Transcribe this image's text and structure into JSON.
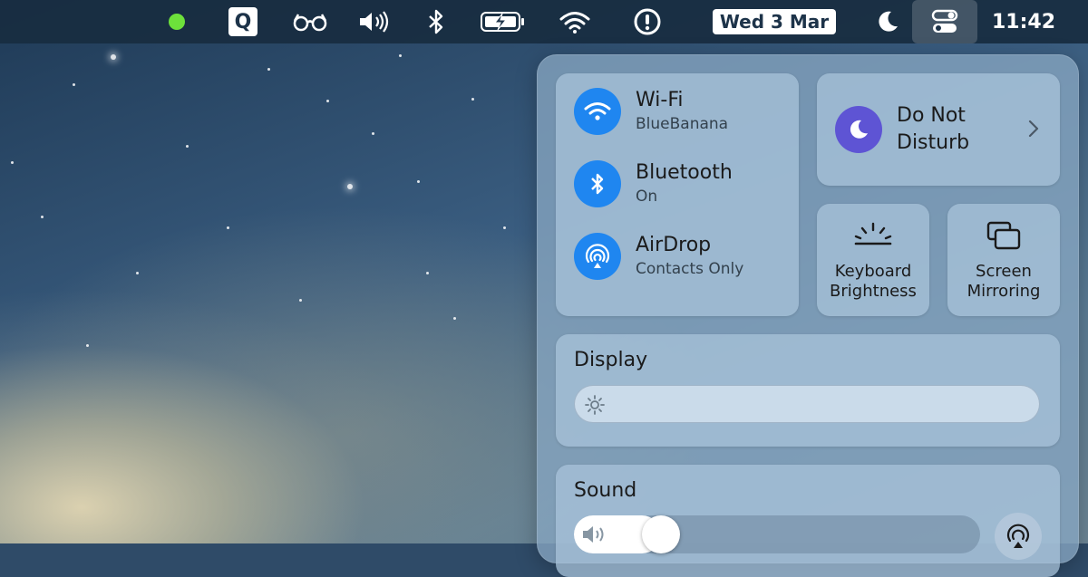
{
  "menubar": {
    "q_label": "Q",
    "date": "Wed 3 Mar",
    "time": "11:42",
    "status_colors": {
      "green_dot": "#6de13b"
    }
  },
  "control_center": {
    "wifi": {
      "title": "Wi-Fi",
      "subtitle": "BlueBanana",
      "icon": "wifi-icon",
      "accent": "#1f86f0"
    },
    "bluetooth": {
      "title": "Bluetooth",
      "subtitle": "On",
      "icon": "bluetooth-icon",
      "accent": "#1f86f0"
    },
    "airdrop": {
      "title": "AirDrop",
      "subtitle": "Contacts Only",
      "icon": "airdrop-icon",
      "accent": "#1f86f0"
    },
    "dnd": {
      "line1": "Do Not",
      "line2": "Disturb",
      "icon": "moon-icon",
      "accent": "#5e54d4"
    },
    "keyboard_brightness": {
      "line1": "Keyboard",
      "line2": "Brightness",
      "icon": "keyboard-brightness-icon"
    },
    "screen_mirroring": {
      "line1": "Screen",
      "line2": "Mirroring",
      "icon": "screen-mirroring-icon"
    },
    "display": {
      "title": "Display",
      "brightness_level": 0.0
    },
    "sound": {
      "title": "Sound",
      "volume_level": 0.1
    }
  }
}
